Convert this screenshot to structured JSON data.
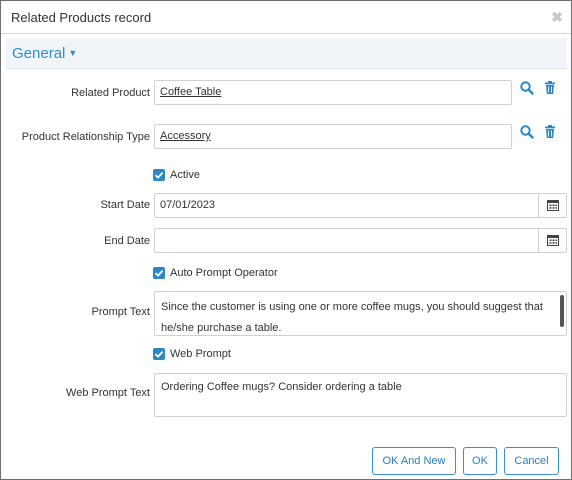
{
  "dialog": {
    "title": "Related Products record"
  },
  "section": {
    "label": "General"
  },
  "fields": {
    "related_product": {
      "label": "Related Product",
      "value": "Coffee Table"
    },
    "relationship_type": {
      "label": "Product Relationship Type",
      "value": "Accessory"
    },
    "active": {
      "label": "Active",
      "checked": true
    },
    "start_date": {
      "label": "Start Date",
      "value": "07/01/2023"
    },
    "end_date": {
      "label": "End Date",
      "value": ""
    },
    "auto_prompt": {
      "label": "Auto Prompt Operator",
      "checked": true
    },
    "prompt_text": {
      "label": "Prompt Text",
      "value": "Since the customer is using one or more coffee mugs, you should suggest that he/she purchase a table."
    },
    "web_prompt": {
      "label": "Web Prompt",
      "checked": true
    },
    "web_prompt_text": {
      "label": "Web Prompt Text",
      "value": "Ordering Coffee mugs? Consider ordering a table"
    }
  },
  "buttons": {
    "ok_and_new": "OK And New",
    "ok": "OK",
    "cancel": "Cancel"
  },
  "colors": {
    "accent": "#2a88c8",
    "section_bg": "#f1f5fa",
    "link": "#1e3a7a"
  },
  "icons": {
    "search": "search-icon",
    "delete": "trash-icon",
    "calendar": "calendar-icon",
    "close": "close-icon",
    "check": "checkmark-icon"
  }
}
